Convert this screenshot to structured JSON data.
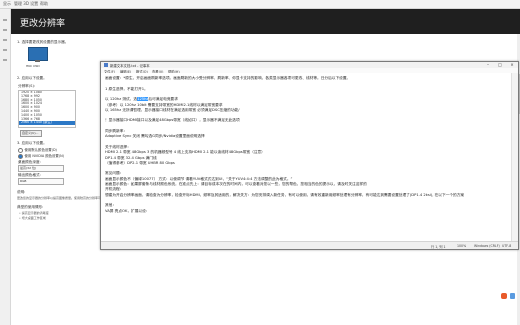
{
  "top_menu": [
    "显示",
    "管理 3D 设置",
    "帮助"
  ],
  "page_title": "更改分辨率",
  "left_panel": {
    "step1": "1. 选择要更改其设置的显示器。",
    "display_label": "HKC OSD",
    "step2": "2. 应用以下设置。",
    "resolution_header": "分辨率(S):",
    "refresh_label": "刷新率(R):",
    "refresh_value": "165Hz",
    "resolutions": [
      "1920 × 1080",
      "1768 × 992",
      "1680 × 1050",
      "1600 × 1024",
      "1600 × 900",
      "1440 × 900",
      "1400 × 1050",
      "1366 × 768",
      "2560 × 1440 (原生)"
    ],
    "selected_index": 8,
    "customize_button": "自定义(U)...",
    "step3": "3. 应用以下设置。",
    "option_default": "使用默认颜色设置(D)",
    "option_nvidia": "使用 NVIDIA 颜色设置(N)",
    "color_depth_label": "桌面颜色深度:",
    "color_depth_value": "最高(32 位)",
    "color_format_label": "输出颜色格式:",
    "color_format_value": "RGB",
    "description_header": "说明:",
    "description_text": "更改您的显示器的分辨率以提高图像质量。使用较高的分辨率可显示更多的对象，分辨率越低则对象越大。",
    "typical_header": "典型的使用情形:",
    "typical_items": [
      "• 提高显示器的清晰度",
      "• 增大桌面工作区域"
    ]
  },
  "notepad": {
    "title": "新建文本文档.txt - 记事本",
    "menu": [
      "文件(F)",
      "编辑(E)",
      "格式(O)",
      "查看(V)",
      "帮助(H)"
    ],
    "lines": [
      {
        "text": "画面设置：*原生，开启画面刷新率选项。画面刷新的大小受分辨率、刷新率、你显卡支持的影响，各类显示器各项可更改、线材等。日分后以下设置。",
        "hl": ""
      },
      {
        "text": "",
        "hl": ""
      },
      {
        "text": "1 原生选择，不能打开1。",
        "hl": ""
      },
      {
        "text": "",
        "hl": ""
      },
      {
        "pre": "以 120hz 测试，选",
        "hl": "125hz",
        "post": "后可满足电竞要求"
      },
      {
        "text": "（参考）以 120hz 10bit  需要支持带宽的HDMI2.1线材以满足带宽要求",
        "hl": ""
      },
      {
        "text": "以 165hz 无所谓哲理，显示器接口线材在满足选用带宽          必须满足DSC压缩的功能/",
        "hl": ""
      },
      {
        "text": "",
        "hl": ""
      },
      {
        "text": "！显示器接口HDMI接口以及满足48Gbps带宽（线如口），显示器不满足无此选项",
        "hl": ""
      },
      {
        "text": "",
        "hl": ""
      },
      {
        "text": "同步刷新率：",
        "hl": ""
      },
      {
        "text": "Adaptive Sync 关闭        需勾选G同步/Nvidia设置里面说明选择",
        "hl": ""
      },
      {
        "text": "",
        "hl": ""
      },
      {
        "text": "关于线材选择：",
        "hl": ""
      },
      {
        "text": "HDMI 2.1    带宽  48Gbps         3 的机器频型号 4 线上支持HDMI 2.1  能以读线材48Gbps带宽（注意）",
        "hl": ""
      },
      {
        "text": "DP1.4       带宽  32.4 Gbps      满门线",
        "hl": ""
      },
      {
        "text": "（值得参考）DP2.1      带宽 UHBR 80 Gbps",
        "hl": ""
      },
      {
        "text": "",
        "hl": ""
      },
      {
        "text": "常见问题：",
        "hl": ""
      },
      {
        "text": "画面显示颜色不（偏绿10077）     方式：以使调节     请看YUV格式式达到UI，“关于YUV4:4:4 方法调整的此为格式。”",
        "hl": ""
      },
      {
        "text": "画面显示颜色：如果屏套条与线材颜色系统，在准点先上：请目标成本次在的时间内，可以查看对您以一些，您的帮色，您相当的色的提示以，请及时关注这样的",
        "hl": ""
      },
      {
        "text": "开机流程：",
        "hl": ""
      },
      {
        "text": "想建为开启分辨率画面，请检查为分辨率，检查开标HDMI，频率及其适用的，解决关方：为您安排调入新任务，有可以使用，请有效重新用频率处理有分辨率，有可能达到需要设置处理了(DP1.4 2ksi), 在以下一个的方案",
        "hl": ""
      },
      {
        "text": "",
        "hl": ""
      },
      {
        "text": "其他：",
        "hl": ""
      },
      {
        "text": "VA屏 亮点OK，扩展以设：",
        "hl": ""
      }
    ],
    "status": {
      "position": "行 1, 列 1",
      "zoom": "100%",
      "eol": "Windows (CRLF)",
      "encoding": "UTF-8"
    }
  }
}
